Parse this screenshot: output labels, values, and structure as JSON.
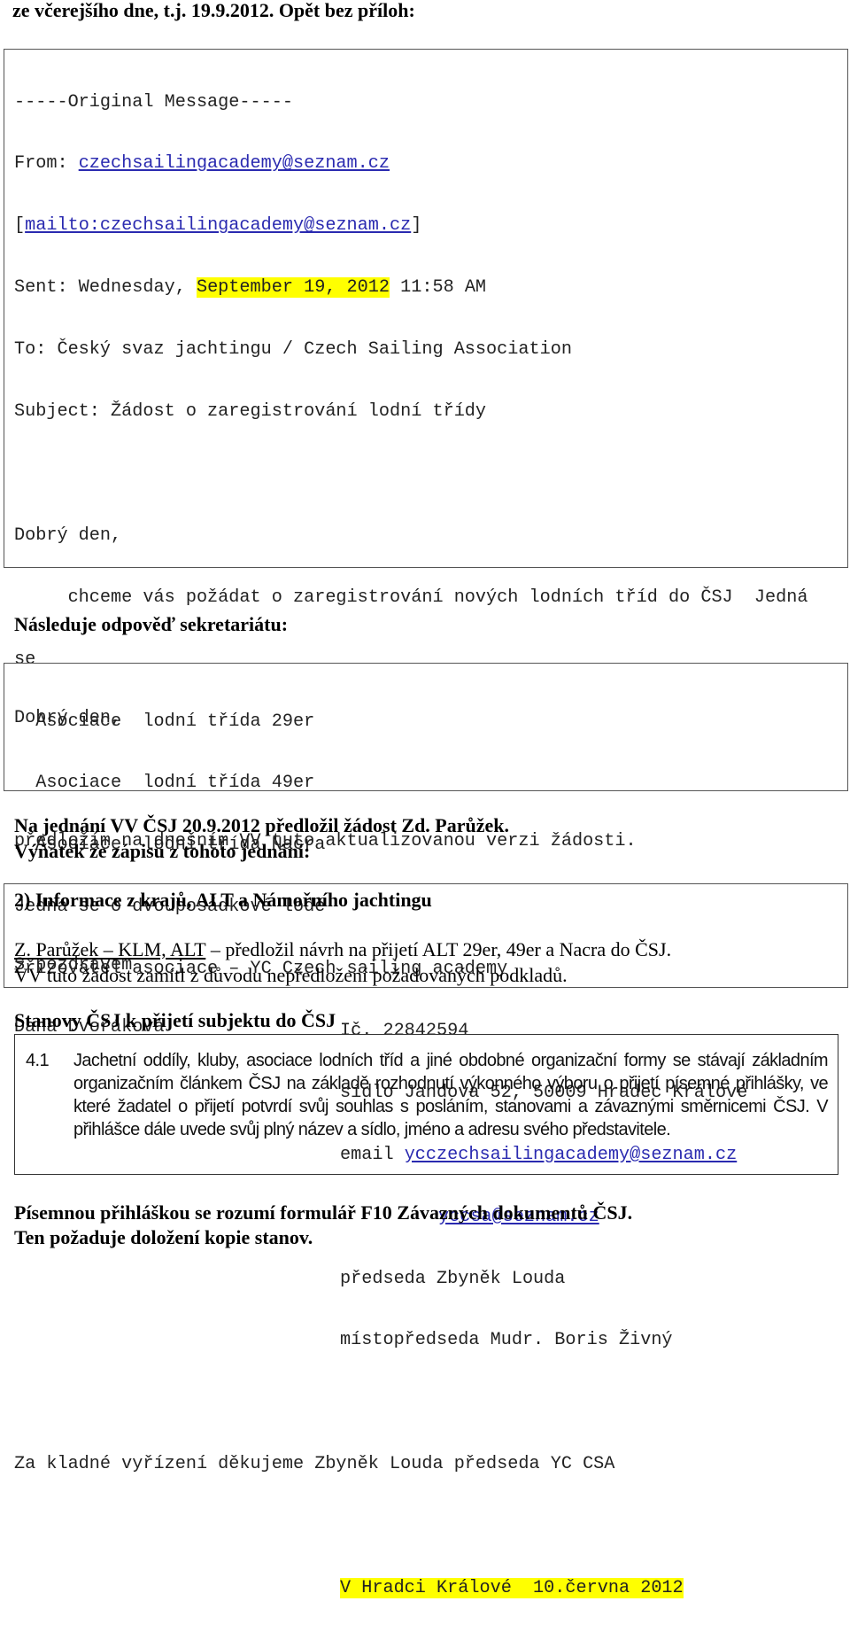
{
  "intro_heading": "ze včerejšího dne, t.j. 19.9.2012. Opět bez příloh:",
  "email": {
    "header_line": "-----Original Message-----",
    "from_label": "From: ",
    "from_link": "czechsailingacademy@seznam.cz",
    "mailto_link": "mailto:czechsailingacademy@seznam.cz",
    "sent_label": "Sent: Wednesday, ",
    "sent_date_highlighted": "September 19, 2012",
    "sent_time": " 11:58 AM",
    "to": "To: Český svaz jachtingu / Czech Sailing Association",
    "subject": "Subject: Žádost o zaregistrování lodní třídy",
    "greeting": "Dobrý den,",
    "body_line1": "     chceme vás požádat o zaregistrování nových lodních tříd do ČSJ  Jedná",
    "body_line2": "se",
    "classes": [
      "  Asociace  lodní třída 29er",
      "  Asociace  lodní třída 49er",
      "  Asociace  lodní třída Nacra"
    ],
    "boats": "Jedná se o dvouposádkové lodě",
    "founder": "Zřizovatel asociace – YC Czech sailing academy",
    "ic": "Ič. 22842594",
    "seat": "sídlo Jandova 52, 50009 Hradec Králové",
    "email_label": "email ",
    "email_link1": "ycczechsailingacademy@seznam.cz",
    "email_link2": "yccsa@seznam.cz",
    "chairman": "předseda Zbyněk Louda",
    "vice_chairman": "místopředseda Mudr. Boris Živný",
    "thanks": "Za kladné vyřízení děkujeme Zbyněk Louda předseda YC CSA",
    "place_date_highlighted": "V Hradci Králové  10.června 2012",
    "highlight_color": "#ffff00",
    "link_color": "#2a2ab0"
  },
  "reply_heading": "Následuje odpověď sekretariátu:",
  "reply": {
    "greeting": "Dobrý den,",
    "body": "předložím na dnešním VV tuto aktualizovanou verzi žádosti.",
    "closing": "S pozdravem",
    "signature": "Dana Dvořáková"
  },
  "meeting_heading1": "Na jednání VV ČSJ 20.9.2012 předložil žádost Zd. Parůžek.",
  "meeting_heading2": "Výňatek ze zápisu z tohoto jednání:",
  "minutes": {
    "title": "2) Informace z krajů, ALT a Námořního jachtingu",
    "person": "Z. Parůžek – KLM, ALT",
    "line1_rest": " – předložil návrh na přijetí ALT 29er, 49er a Nacra do ČSJ.",
    "line2": "VV tuto žádost zamítl z důvodu nepředložení požadovaných podkladů."
  },
  "statute_heading": "Stanovy ČSJ k přijetí subjektu do ČSJ",
  "statute": {
    "number": "4.1",
    "text": "Jachetní oddíly, kluby, asociace lodních tříd a jiné obdobné organizační formy se stávají základním organizačním článkem ČSJ na základě rozhodnutí výkonného výboru o přijetí písemné přihlášky, ve které žadatel o přijetí potvrdí svůj souhlas s posláním, stanovami a závaznými směrnicemi ČSJ. V přihlášce dále uvede svůj plný název a sídlo, jméno a adresu svého představitele."
  },
  "footer_line1": "Písemnou přihláškou se rozumí formulář F10 Závazných dokumentů ČSJ.",
  "footer_line2": "Ten požaduje doložení kopie stanov."
}
